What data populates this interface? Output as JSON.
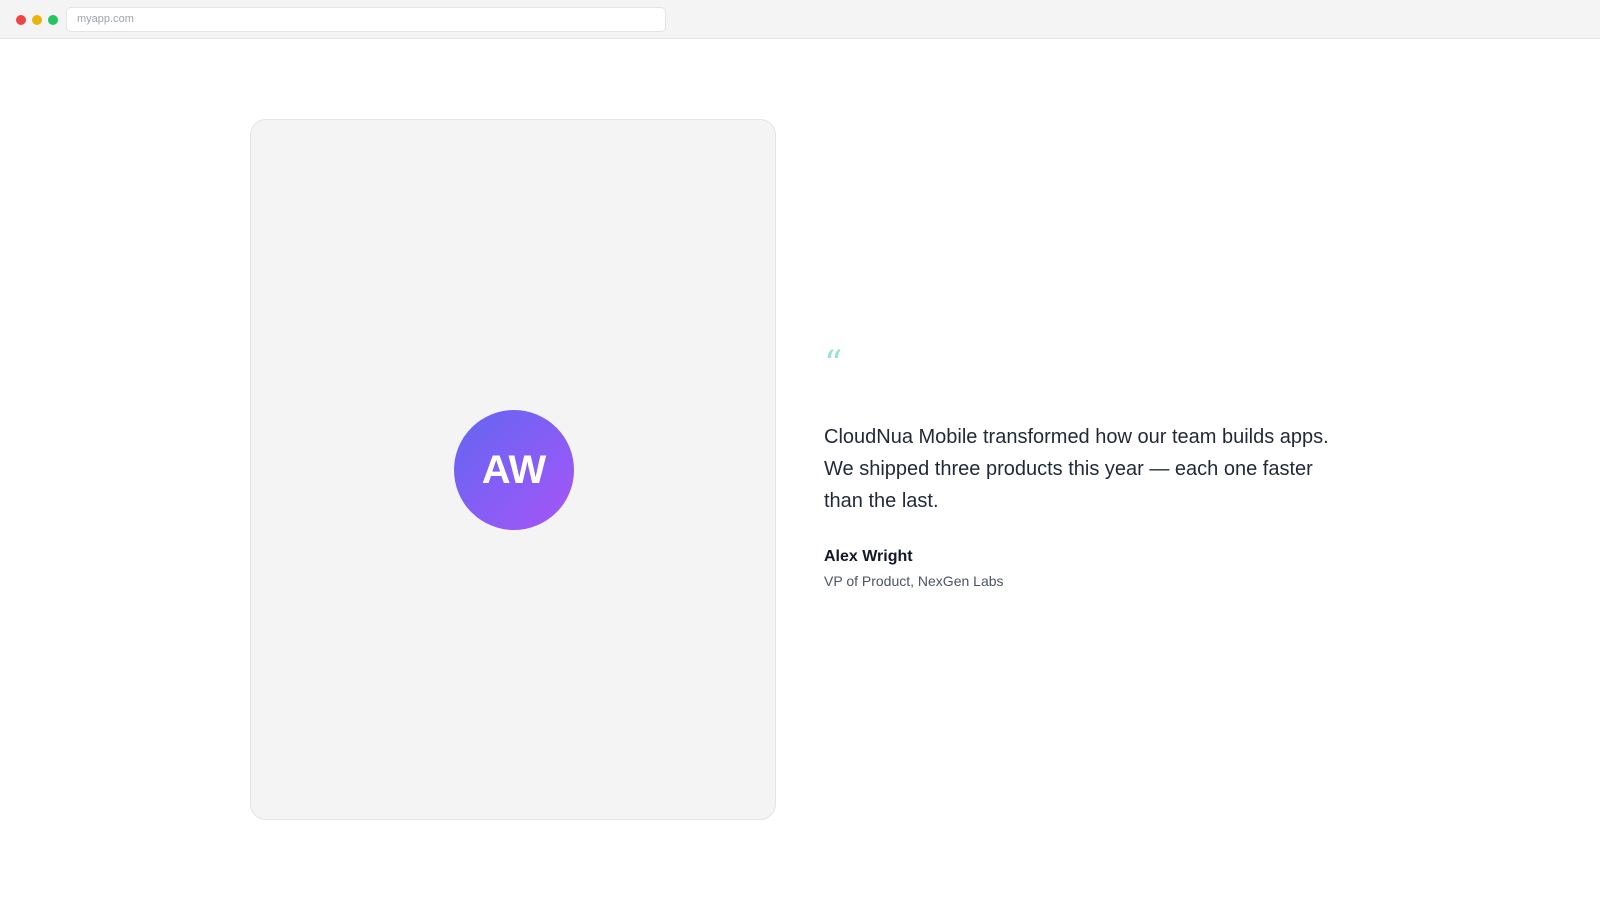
{
  "browser": {
    "url": "myapp.com"
  },
  "testimonial": {
    "avatar_initials": "AW",
    "quote_mark": "“",
    "quote": "CloudNua Mobile transformed how our team builds apps. We shipped three products this year — each one faster than the last.",
    "author_name": "Alex Wright",
    "author_title": "VP of Product, NexGen Labs"
  },
  "colors": {
    "accent_quote_mark": "#99e2d8",
    "avatar_gradient_start": "#6366f1",
    "avatar_gradient_end": "#a855f7",
    "card_background": "#f4f4f5"
  }
}
